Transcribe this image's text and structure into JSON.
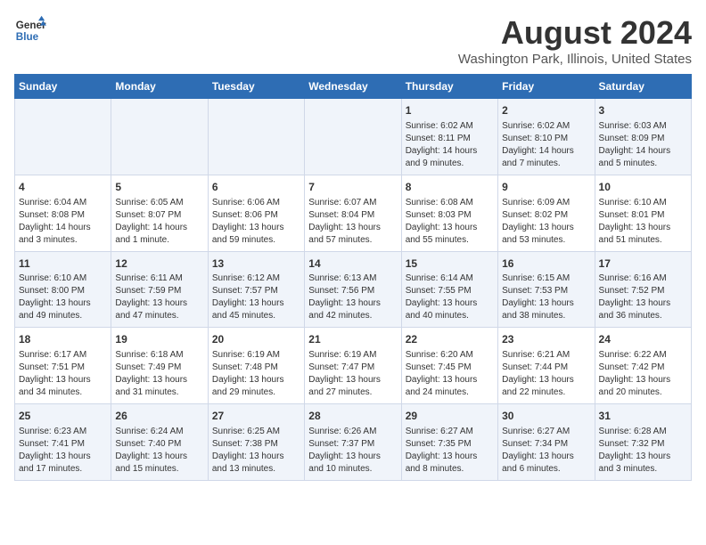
{
  "header": {
    "logo_line1": "General",
    "logo_line2": "Blue",
    "main_title": "August 2024",
    "subtitle": "Washington Park, Illinois, United States"
  },
  "days_of_week": [
    "Sunday",
    "Monday",
    "Tuesday",
    "Wednesday",
    "Thursday",
    "Friday",
    "Saturday"
  ],
  "weeks": [
    [
      {
        "day": "",
        "info": ""
      },
      {
        "day": "",
        "info": ""
      },
      {
        "day": "",
        "info": ""
      },
      {
        "day": "",
        "info": ""
      },
      {
        "day": "1",
        "info": "Sunrise: 6:02 AM\nSunset: 8:11 PM\nDaylight: 14 hours\nand 9 minutes."
      },
      {
        "day": "2",
        "info": "Sunrise: 6:02 AM\nSunset: 8:10 PM\nDaylight: 14 hours\nand 7 minutes."
      },
      {
        "day": "3",
        "info": "Sunrise: 6:03 AM\nSunset: 8:09 PM\nDaylight: 14 hours\nand 5 minutes."
      }
    ],
    [
      {
        "day": "4",
        "info": "Sunrise: 6:04 AM\nSunset: 8:08 PM\nDaylight: 14 hours\nand 3 minutes."
      },
      {
        "day": "5",
        "info": "Sunrise: 6:05 AM\nSunset: 8:07 PM\nDaylight: 14 hours\nand 1 minute."
      },
      {
        "day": "6",
        "info": "Sunrise: 6:06 AM\nSunset: 8:06 PM\nDaylight: 13 hours\nand 59 minutes."
      },
      {
        "day": "7",
        "info": "Sunrise: 6:07 AM\nSunset: 8:04 PM\nDaylight: 13 hours\nand 57 minutes."
      },
      {
        "day": "8",
        "info": "Sunrise: 6:08 AM\nSunset: 8:03 PM\nDaylight: 13 hours\nand 55 minutes."
      },
      {
        "day": "9",
        "info": "Sunrise: 6:09 AM\nSunset: 8:02 PM\nDaylight: 13 hours\nand 53 minutes."
      },
      {
        "day": "10",
        "info": "Sunrise: 6:10 AM\nSunset: 8:01 PM\nDaylight: 13 hours\nand 51 minutes."
      }
    ],
    [
      {
        "day": "11",
        "info": "Sunrise: 6:10 AM\nSunset: 8:00 PM\nDaylight: 13 hours\nand 49 minutes."
      },
      {
        "day": "12",
        "info": "Sunrise: 6:11 AM\nSunset: 7:59 PM\nDaylight: 13 hours\nand 47 minutes."
      },
      {
        "day": "13",
        "info": "Sunrise: 6:12 AM\nSunset: 7:57 PM\nDaylight: 13 hours\nand 45 minutes."
      },
      {
        "day": "14",
        "info": "Sunrise: 6:13 AM\nSunset: 7:56 PM\nDaylight: 13 hours\nand 42 minutes."
      },
      {
        "day": "15",
        "info": "Sunrise: 6:14 AM\nSunset: 7:55 PM\nDaylight: 13 hours\nand 40 minutes."
      },
      {
        "day": "16",
        "info": "Sunrise: 6:15 AM\nSunset: 7:53 PM\nDaylight: 13 hours\nand 38 minutes."
      },
      {
        "day": "17",
        "info": "Sunrise: 6:16 AM\nSunset: 7:52 PM\nDaylight: 13 hours\nand 36 minutes."
      }
    ],
    [
      {
        "day": "18",
        "info": "Sunrise: 6:17 AM\nSunset: 7:51 PM\nDaylight: 13 hours\nand 34 minutes."
      },
      {
        "day": "19",
        "info": "Sunrise: 6:18 AM\nSunset: 7:49 PM\nDaylight: 13 hours\nand 31 minutes."
      },
      {
        "day": "20",
        "info": "Sunrise: 6:19 AM\nSunset: 7:48 PM\nDaylight: 13 hours\nand 29 minutes."
      },
      {
        "day": "21",
        "info": "Sunrise: 6:19 AM\nSunset: 7:47 PM\nDaylight: 13 hours\nand 27 minutes."
      },
      {
        "day": "22",
        "info": "Sunrise: 6:20 AM\nSunset: 7:45 PM\nDaylight: 13 hours\nand 24 minutes."
      },
      {
        "day": "23",
        "info": "Sunrise: 6:21 AM\nSunset: 7:44 PM\nDaylight: 13 hours\nand 22 minutes."
      },
      {
        "day": "24",
        "info": "Sunrise: 6:22 AM\nSunset: 7:42 PM\nDaylight: 13 hours\nand 20 minutes."
      }
    ],
    [
      {
        "day": "25",
        "info": "Sunrise: 6:23 AM\nSunset: 7:41 PM\nDaylight: 13 hours\nand 17 minutes."
      },
      {
        "day": "26",
        "info": "Sunrise: 6:24 AM\nSunset: 7:40 PM\nDaylight: 13 hours\nand 15 minutes."
      },
      {
        "day": "27",
        "info": "Sunrise: 6:25 AM\nSunset: 7:38 PM\nDaylight: 13 hours\nand 13 minutes."
      },
      {
        "day": "28",
        "info": "Sunrise: 6:26 AM\nSunset: 7:37 PM\nDaylight: 13 hours\nand 10 minutes."
      },
      {
        "day": "29",
        "info": "Sunrise: 6:27 AM\nSunset: 7:35 PM\nDaylight: 13 hours\nand 8 minutes."
      },
      {
        "day": "30",
        "info": "Sunrise: 6:27 AM\nSunset: 7:34 PM\nDaylight: 13 hours\nand 6 minutes."
      },
      {
        "day": "31",
        "info": "Sunrise: 6:28 AM\nSunset: 7:32 PM\nDaylight: 13 hours\nand 3 minutes."
      }
    ]
  ]
}
